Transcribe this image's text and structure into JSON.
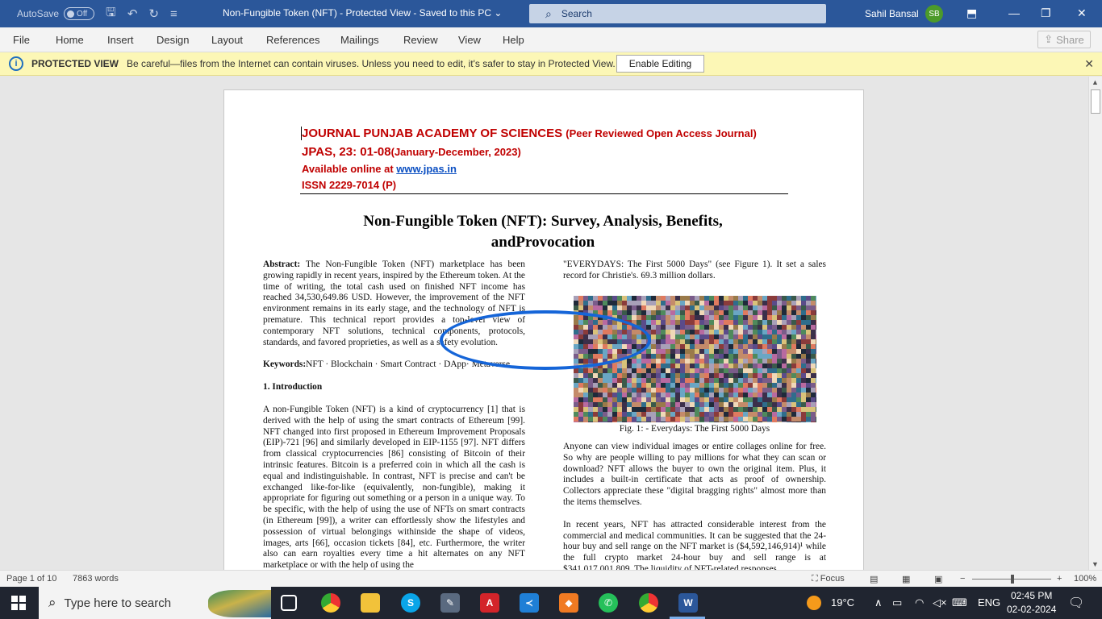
{
  "titlebar": {
    "autosave_label": "AutoSave",
    "autosave_state": "Off",
    "doc_title": "Non-Fungible Token (NFT)  -  Protected View  -  Saved to this PC",
    "search_placeholder": "Search",
    "user_name": "Sahil Bansal",
    "user_initials": "SB"
  },
  "menu": {
    "tabs": [
      "File",
      "Home",
      "Insert",
      "Design",
      "Layout",
      "References",
      "Mailings",
      "Review",
      "View",
      "Help"
    ],
    "share_label": "Share"
  },
  "protected_view": {
    "title": "PROTECTED VIEW",
    "message": "Be careful—files from the Internet can contain viruses. Unless you need to edit, it's safer to stay in Protected View.",
    "button": "Enable Editing"
  },
  "document": {
    "header": {
      "line1_main": "JOURNAL PUNJAB ACADEMY OF SCIENCES ",
      "line1_sub": "(Peer Reviewed Open Access Journal)",
      "line2_main": "JPAS, 23: 01-08",
      "line2_sub": "(January-December, 2023)",
      "line3_prefix": "Available online at ",
      "line3_link": "www.jpas.in",
      "line4": "ISSN 2229-7014 (P)"
    },
    "title_line1": "Non-Fungible Token (NFT): Survey, Analysis, Benefits,",
    "title_line2": "andProvocation",
    "abstract_label": "Abstract:",
    "abstract_text": " The Non-Fungible Token (NFT) marketplace has been growing rapidly in recent years, inspired by the Ethereum token. At the time of writing, the total cash used on finished NFT income has reached 34,530,649.86 USD. However, the improvement of the NFT environment remains in its early stage, and the technology of NFT is premature. This technical report provides a top-level view of contemporary NFT solutions, technical components, protocols, standards, and favored proprieties, as well as a safety evolution.",
    "keywords_label": "Keywords:",
    "keywords_text": "NFT · Blockchain · Smart Contract · DApp· Metaverse",
    "section1_heading": "1. Introduction",
    "intro_text": "A non-Fungible Token (NFT) is a kind of cryptocurrency [1] that is derived with the help of using the smart contracts of Ethereum [99]. NFT changed into first proposed in Ethereum Improvement Proposals (EIP)-721 [96] and similarly developed in EIP-1155 [97]. NFT differs from classical cryptocurrencies [86] consisting of Bitcoin of their intrinsic features. Bitcoin is a preferred coin in which all the cash is equal and indistinguishable. In contrast, NFT is precise and can't be exchanged like-for-like (equivalently, non-fungible), making it appropriate for figuring out something or a person in a unique way. To be specific, with the help of using the use of NFTs on smart contracts (in Ethereum [99]), a writer can effortlessly show the lifestyles and possession of virtual belongings withinside the shape of videos, images, arts [66], occasion tickets [84], etc. Furthermore, the writer also can earn royalties every time a hit alternates on any NFT marketplace or with the help of using the",
    "right_top_text": "\"EVERYDAYS: The First 5000 Days\" (see Figure 1). It set a sales record for Christie's.  69.3 million dollars.",
    "figure_caption": "Fig. 1: - Everydays: The First 5000 Days",
    "right_para1": "Anyone can view individual images or entire collages online for free. So why are people willing to pay millions for what they can scan or download?  NFT allows the buyer to own the original item. Plus, it includes a built-in certificate that acts as proof of ownership. Collectors appreciate these \"digital bragging rights\" almost more than the items themselves.",
    "right_para2": "In recent years, NFT has attracted considerable interest from the commercial and medical communities. It can be suggested that the 24-hour buy and sell range on the NFT market is ($4,592,146,914)¹ while the full crypto market 24-hour buy and sell range is at $341,017,001,809.   The   liquidity   of   NFT-related   responses"
  },
  "statusbar": {
    "page": "Page 1 of 10",
    "words": "7863 words",
    "focus": "Focus",
    "zoom": "100%"
  },
  "taskbar": {
    "search_placeholder": "Type here to search",
    "weather": "19°C",
    "language": "ENG",
    "time": "02:45 PM",
    "date": "02-02-2024"
  }
}
